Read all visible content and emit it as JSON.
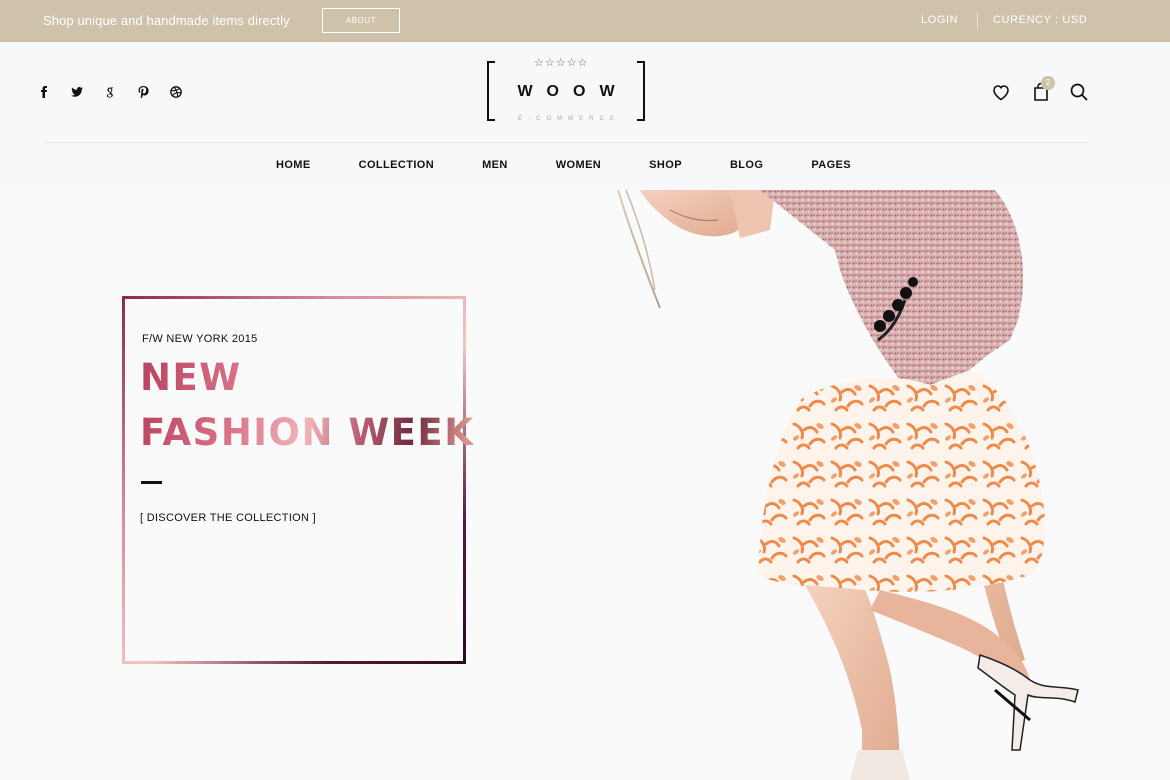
{
  "topbar": {
    "tagline": "Shop unique and handmade items directly",
    "about_label": "ABOUT",
    "login_label": "LOGIN",
    "currency_label": "CURENCY : USD"
  },
  "header": {
    "social_icons": [
      "facebook-icon",
      "twitter-icon",
      "google-plus-icon",
      "pinterest-icon",
      "dribbble-icon"
    ],
    "logo": {
      "word": "WOOW",
      "sub": "E-COMMERCE",
      "stars": "☆☆☆☆☆"
    },
    "cart_count": "2",
    "action_icons": [
      "heart-icon",
      "bag-icon",
      "search-icon"
    ]
  },
  "nav": {
    "items": [
      {
        "label": "HOME"
      },
      {
        "label": "COLLECTION"
      },
      {
        "label": "MEN"
      },
      {
        "label": "WOMEN"
      },
      {
        "label": "SHOP"
      },
      {
        "label": "BLOG"
      },
      {
        "label": "PAGES"
      }
    ]
  },
  "hero": {
    "eyebrow": "F/W NEW YORK 2015",
    "headline_line1": "NEW",
    "headline_line2": "FASHION WEEK",
    "cta": "[ DISCOVER THE COLLECTION ]"
  },
  "colors": {
    "topbar_bg": "#cfc2aa",
    "accent": "#b8405f"
  }
}
